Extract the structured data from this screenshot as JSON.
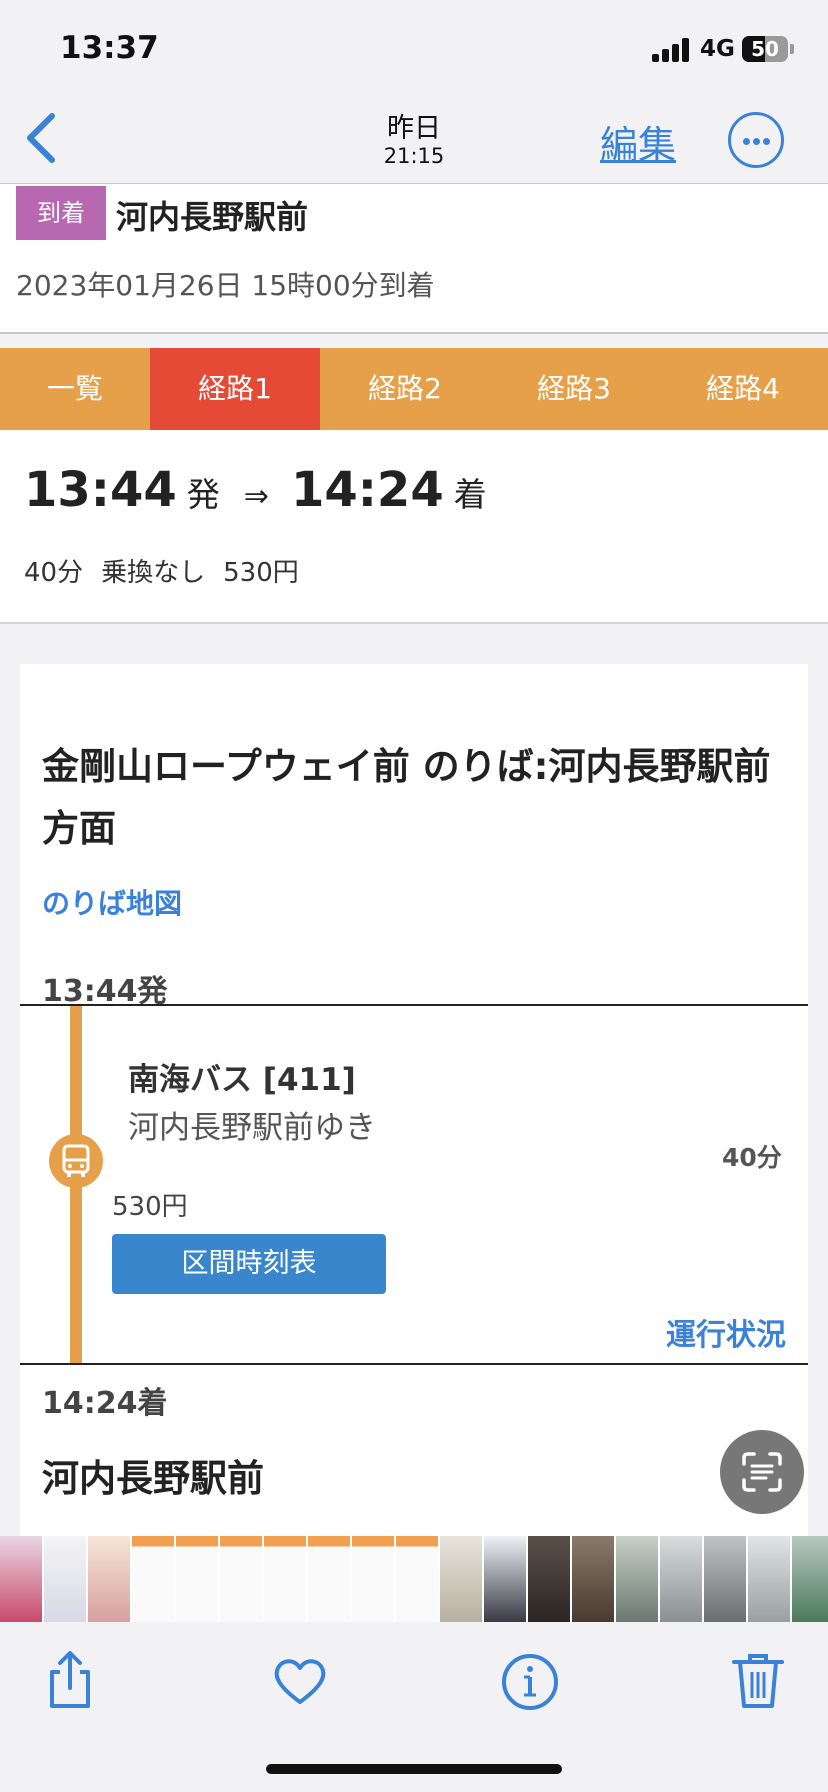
{
  "status_bar": {
    "time": "13:37",
    "network": "4G",
    "battery": "50"
  },
  "nav": {
    "title": "昨日",
    "subtitle": "21:15",
    "edit_label": "編集"
  },
  "arrival": {
    "badge": "到着",
    "station": "河内長野駅前",
    "datetime": "2023年01月26日 15時00分到着"
  },
  "tabs": [
    {
      "label": "一覧",
      "active": false
    },
    {
      "label": "経路1",
      "active": true
    },
    {
      "label": "経路2",
      "active": false
    },
    {
      "label": "経路3",
      "active": false
    },
    {
      "label": "経路4",
      "active": false
    }
  ],
  "summary": {
    "depart_time": "13:44",
    "depart_label": "発",
    "arrow": "⇒",
    "arrive_time": "14:24",
    "arrive_label": "着",
    "duration": "40分",
    "transfers": "乗換なし",
    "fare": "530円"
  },
  "route": {
    "stop_name": "金剛山ロープウェイ前 のりば:河内長野駅前方面",
    "platform_map": "のりば地図",
    "depart": "13:44発",
    "bus_name": "南海バス [411]",
    "bus_dest": "河内長野駅前ゆき",
    "duration": "40分",
    "fare": "530円",
    "timetable_button": "区間時刻表",
    "status_link": "運行状況",
    "arrive": "14:24着",
    "arrive_stop": "河内長野駅前"
  },
  "colors": {
    "accent_blue": "#3a82d8",
    "tab_orange": "#e6a04a",
    "tab_active_red": "#e44a36",
    "arrive_badge": "#b768b0"
  },
  "icons": {
    "back": "chevron-left-icon",
    "more": "ellipsis-circle-icon",
    "bus": "bus-icon",
    "scan": "live-text-scan-icon",
    "share": "share-icon",
    "favorite": "heart-icon",
    "info": "info-icon",
    "delete": "trash-icon"
  }
}
